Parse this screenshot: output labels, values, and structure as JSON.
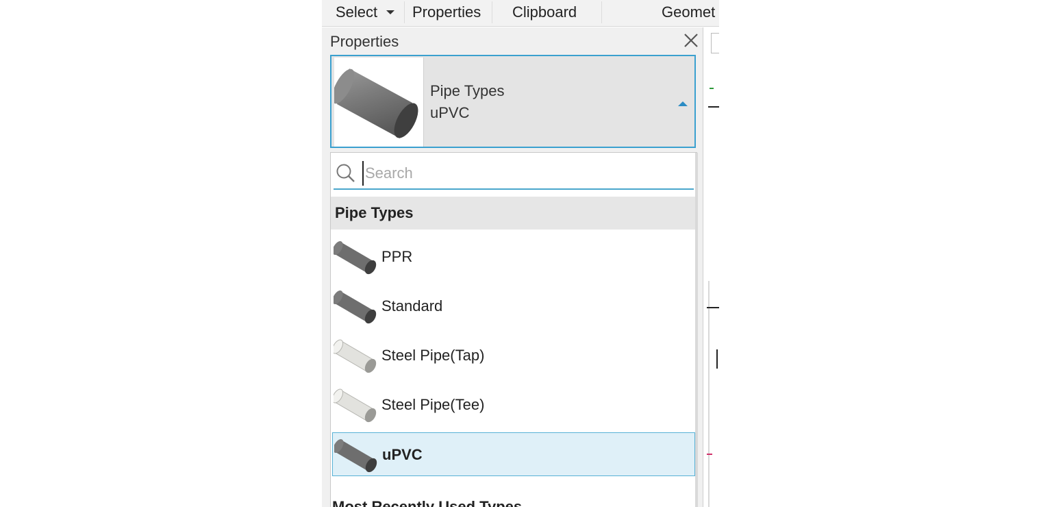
{
  "ribbon": {
    "select_label": "Select",
    "properties_label": "Properties",
    "clipboard_label": "Clipboard",
    "geometry_label": "Geomet"
  },
  "palette": {
    "title": "Properties",
    "selector": {
      "type_label": "Pipe Types",
      "name_label": "uPVC"
    },
    "search": {
      "placeholder": "Search",
      "value": ""
    },
    "group_header": "Pipe Types",
    "items": [
      {
        "label": "PPR",
        "icon": "pipe-dark-icon"
      },
      {
        "label": "Standard",
        "icon": "pipe-dark-icon"
      },
      {
        "label": "Steel Pipe(Tap)",
        "icon": "pipe-light-icon"
      },
      {
        "label": "Steel Pipe(Tee)",
        "icon": "pipe-light-icon"
      },
      {
        "label": "uPVC",
        "icon": "pipe-dark-icon",
        "selected": true
      }
    ],
    "recent_header": "Most Recently Used Types"
  },
  "colors": {
    "accent": "#3aa0cf",
    "selected_bg": "#dff0f8",
    "pipe_dark": "#6e6e6e",
    "pipe_light": "#d8d8d4"
  }
}
